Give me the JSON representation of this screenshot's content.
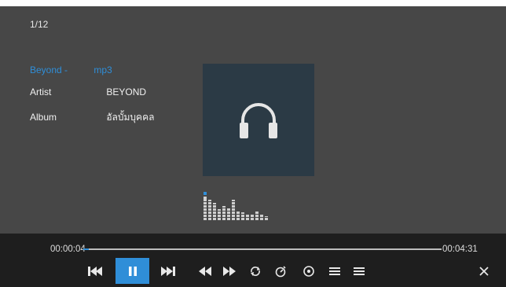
{
  "track_counter": "1/12",
  "track": {
    "title": "Beyond -",
    "ext": "mp3",
    "artist_label": "Artist",
    "artist": "BEYOND",
    "album_label": "Album",
    "album": "อัลบั้มบุคคล"
  },
  "player": {
    "current_time": "00:00:04",
    "total_time": "00:04:31",
    "progress": 0.015
  },
  "colors": {
    "background": "#474747",
    "accent": "#2f8ed8",
    "controls_bar": "#1e1e1e",
    "cover": "#2b3a45"
  },
  "icons": [
    "headphones-icon",
    "previous-track-icon",
    "pause-icon",
    "next-track-icon",
    "rewind-icon",
    "fast-forward-icon",
    "repeat-icon",
    "timer-icon",
    "info-icon",
    "playlist-icon",
    "menu-icon",
    "close-icon"
  ]
}
